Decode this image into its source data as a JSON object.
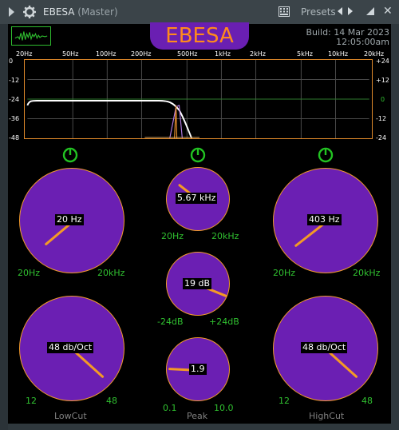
{
  "window": {
    "title": "EBESA",
    "subtitle": "(Master)",
    "presets_label": "Presets",
    "close_glyph": "✕"
  },
  "plugin": {
    "name": "EBESA",
    "build_line1": "Build: 14 Mar 2023",
    "build_line2": "12:05:00am"
  },
  "graph": {
    "freq_labels": [
      "20Hz",
      "50Hz",
      "100Hz",
      "200Hz",
      "500Hz",
      "1kHz",
      "2kHz",
      "5kHz",
      "10kHz",
      "20kHz"
    ],
    "db_left": [
      "0",
      "-12",
      "-24",
      "-36",
      "-48"
    ],
    "db_right": [
      "+24",
      "+12",
      "0",
      "-12",
      "-24"
    ],
    "colors": {
      "border": "#e08a2a",
      "grid": "#4a4a4a",
      "curve": "#ffffff"
    }
  },
  "bands": {
    "lowcut": {
      "label": "LowCut",
      "freq_value": "20 Hz",
      "freq_min": "20Hz",
      "freq_max": "20kHz",
      "slope_value": "48 db/Oct",
      "slope_min": "12",
      "slope_max": "48",
      "power_on": true
    },
    "peak": {
      "label": "Peak",
      "freq_value": "5.67 kHz",
      "freq_min": "20Hz",
      "freq_max": "20kHz",
      "gain_value": "19 dB",
      "gain_min": "-24dB",
      "gain_max": "+24dB",
      "q_value": "1.9",
      "q_min": "0.1",
      "q_max": "10.0",
      "power_on": true
    },
    "highcut": {
      "label": "HighCut",
      "freq_value": "403 Hz",
      "freq_min": "20Hz",
      "freq_max": "20kHz",
      "slope_value": "48 db/Oct",
      "slope_min": "12",
      "slope_max": "48",
      "power_on": true
    }
  },
  "colors": {
    "knob_fill": "#6b1fb3",
    "knob_ring": "#f19a2d",
    "accent_orange": "#ff8a1c",
    "range_green": "#30c030",
    "power_green": "#22c322"
  }
}
